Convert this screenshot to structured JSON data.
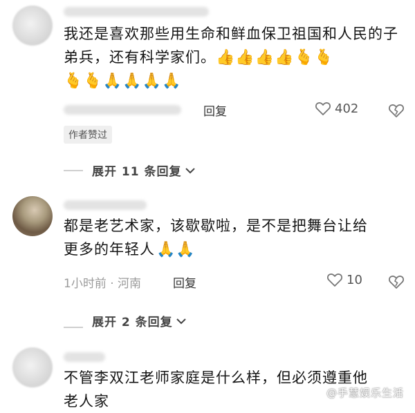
{
  "comments": [
    {
      "text": "我还是喜欢那些用生命和鲜血保卫祖国和人民的子弟兵，还有科学家们。",
      "emojis_line1": "👍👍👍👍🫰🫰",
      "emojis_line2": "🫰🫰🙏🙏🙏🙏",
      "reply_label": "回复",
      "likes": "402",
      "author_liked_tag": "作者赞过",
      "expand_label": "展开 11 条回复"
    },
    {
      "line1": "都是老艺术家，该歇歇啦，是不是把舞台让给",
      "line2": "更多的年轻人",
      "emojis": "🙏🙏",
      "meta": "1小时前 · 河南",
      "reply_label": "回复",
      "likes": "10",
      "expand_label": "展开 2 条回复"
    },
    {
      "line1": "不管李双江老师家庭是什么样，但必须遵重他",
      "line2": "老人家"
    }
  ],
  "watermark": "@手慧娱乐生活",
  "icons": {
    "like": "heart-outline-icon",
    "dislike": "broken-heart-icon",
    "expand": "chevron-down-icon"
  }
}
